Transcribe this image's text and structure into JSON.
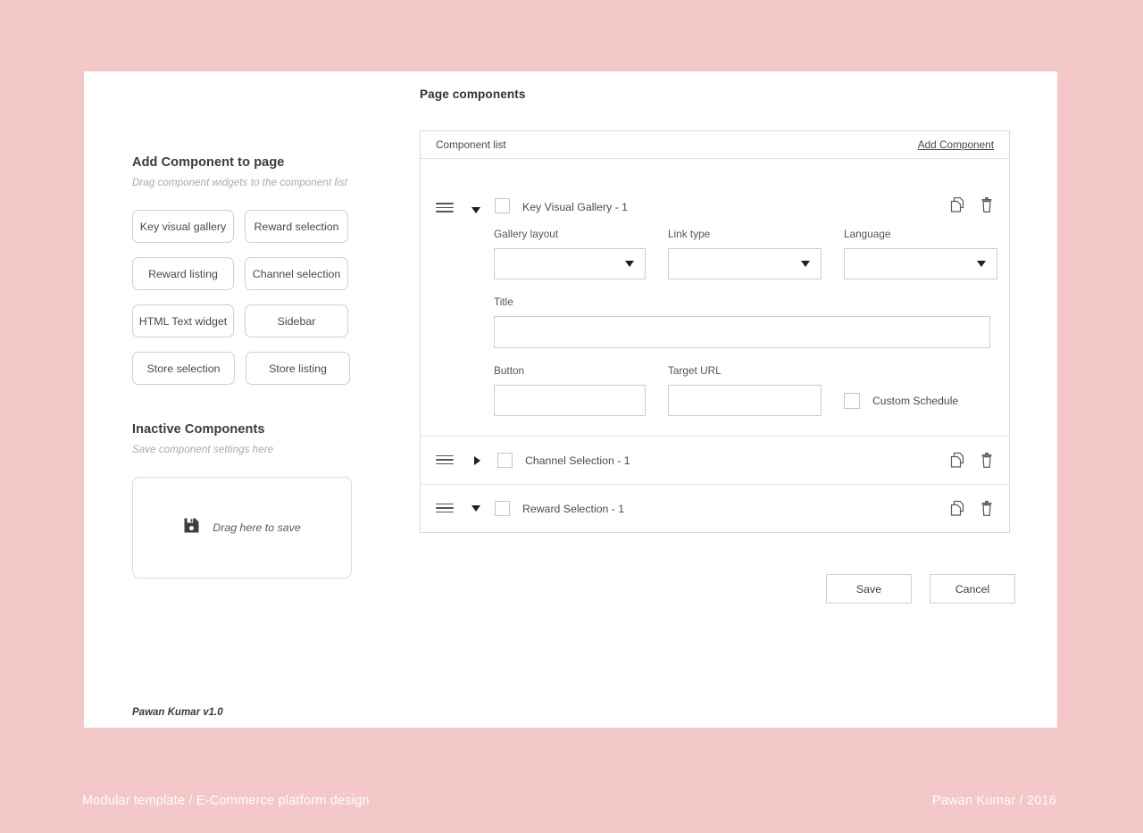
{
  "theme": {
    "page_bg": "#f4c7c9",
    "card_bg": "#ffffff",
    "border": "#d9d9d9",
    "text": "#4a4a4a"
  },
  "left": {
    "add_section": {
      "title": "Add Component to page",
      "subtitle": "Drag component widgets to the component list",
      "widgets": [
        "Key visual gallery",
        "Reward selection",
        "Reward listing",
        "Channel selection",
        "HTML Text widget",
        "Sidebar",
        "Store selection",
        "Store listing"
      ]
    },
    "inactive_section": {
      "title": "Inactive Components",
      "subtitle": "Save component settings here",
      "dropzone_label": "Drag here to save",
      "dropzone_icon": "save-icon"
    },
    "app_version": "Pawan Kumar v1.0"
  },
  "right": {
    "page_title": "Page components",
    "panel": {
      "header_title": "Component list",
      "add_component_label": "Add Component"
    },
    "components": [
      {
        "name": "Key Visual Gallery - 1",
        "expanded": true,
        "checked": false,
        "caret": "caret-down",
        "form": {
          "gallery_layout": {
            "label": "Gallery layout",
            "value": ""
          },
          "link_type": {
            "label": "Link type",
            "value": ""
          },
          "language": {
            "label": "Language",
            "value": ""
          },
          "title": {
            "label": "Title",
            "value": ""
          },
          "button": {
            "label": "Button",
            "value": ""
          },
          "target_url": {
            "label": "Target URL",
            "value": ""
          },
          "custom_schedule": {
            "label": "Custom Schedule",
            "checked": false
          }
        }
      },
      {
        "name": "Channel Selection - 1",
        "expanded": false,
        "checked": false,
        "caret": "caret-right"
      },
      {
        "name": "Reward Selection - 1",
        "expanded": false,
        "checked": false,
        "caret": "caret-down"
      }
    ],
    "actions": {
      "save_label": "Save",
      "cancel_label": "Cancel"
    },
    "row_icons": {
      "duplicate": "duplicate-icon",
      "delete": "trash-icon",
      "drag": "drag-handle-icon"
    }
  },
  "captions": {
    "left": "Modular template / E-Commerce platform design",
    "right": "Pawan Kumar / 2016"
  }
}
